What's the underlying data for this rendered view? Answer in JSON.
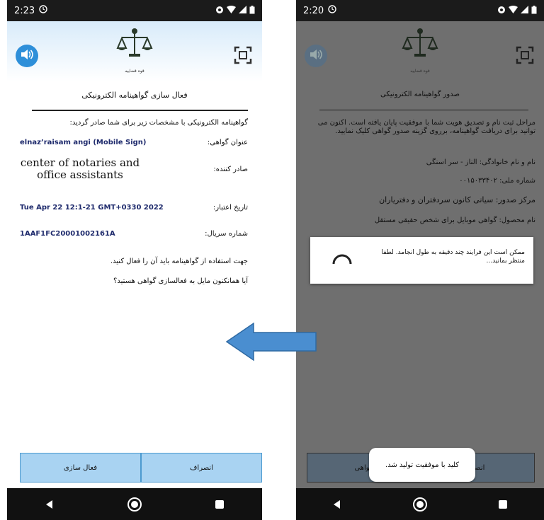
{
  "left": {
    "status": {
      "time": "2:23"
    },
    "logo_caption": "قوه قضاییه",
    "title": "فعال سازی گواهینامه الکترونیکی",
    "intro": "گواهینامه الکترونیکی با مشخصات زیر برای شما صادر گردید:",
    "fields": [
      {
        "label": "عنوان گواهی:",
        "value": "elnaz’raisam angi (Mobile Sign)"
      },
      {
        "label": "صادر کننده:",
        "value": "center of notaries and office assistants"
      },
      {
        "label": "تاریخ اعتبار:",
        "value": "Tue Apr 22 12:1-21 GMT+0330 2022"
      },
      {
        "label": "شماره سریال:",
        "value": "1AAF1FC20001002161A"
      }
    ],
    "para1": "جهت استفاده از گواهینامه باید آن را فعال کنید.",
    "para2": "آیا همانکنون مایل به فعالسازی گواهی هستید؟",
    "buttons": {
      "activate": "فعال سازی",
      "cancel": "انصراف"
    }
  },
  "right": {
    "status": {
      "time": "2:20"
    },
    "logo_caption": "قوه قضاییه",
    "title": "صدور گواهینامه الکترونیکی",
    "intro": "مراحل ثبت نام و تصدیق هویت شما با موفقیت پایان یافته است. اکنون می توانید برای دریافت گواهینامه، برروی گزینه صدور گواهی کلیک نمایید.",
    "name_line": "نام و نام خانوادگی: الناز - سر اسنگی",
    "national_id": "شماره ملی: ۰۰۱۵۰۳۳۴۰۲",
    "issuer_line": "مرکز صدور: سیاتی کانون سردفتران و دفتریاران",
    "product_line": "نام محصول: گواهی موبایل برای شخص حقیقی مستقل",
    "dialog_msg": "ممکن است این فرایند چند دقیقه به طول انجامد. لطفا منتظر بمانید...",
    "btn_left": "گواهی",
    "btn_right": "انصر",
    "toast": "کلید با موفقیت تولید شد."
  },
  "colors": {
    "accent": "#2e8fd9",
    "button_fill": "#a9d3f2",
    "arrow": "#4a8ed0"
  }
}
